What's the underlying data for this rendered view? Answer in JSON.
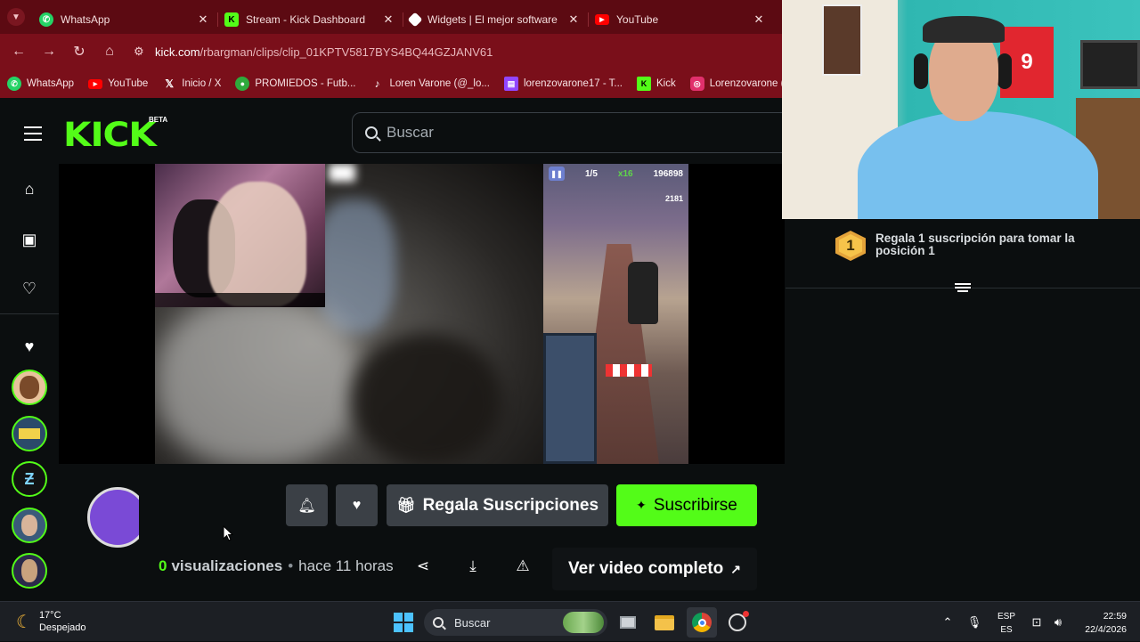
{
  "browser": {
    "tabs": [
      {
        "title": "WhatsApp",
        "icon": "whatsapp-icon",
        "color": "#25d366"
      },
      {
        "title": "Stream - Kick Dashboard",
        "icon": "kick-icon",
        "color": "#53fc18"
      },
      {
        "title": "Widgets | El mejor software",
        "icon": "widget-icon",
        "color": "#ffffff"
      },
      {
        "title": "YouTube",
        "icon": "youtube-icon",
        "color": "#ff0000"
      }
    ],
    "close_glyph": "✕",
    "url_host": "kick.com",
    "url_path": "/rbargman/clips/clip_01KPTV5817BYS4BQ44GZJANV61",
    "bookmarks": [
      {
        "label": "WhatsApp",
        "icon": "whatsapp-icon",
        "color": "#25d366"
      },
      {
        "label": "YouTube",
        "icon": "youtube-icon",
        "color": "#ff0000"
      },
      {
        "label": "Inicio / X",
        "icon": "x-icon",
        "color": "#000000"
      },
      {
        "label": "PROMIEDOS - Futb...",
        "icon": "promiedos-icon",
        "color": "#2eaa3c"
      },
      {
        "label": "Loren Varone (@_lo...",
        "icon": "tiktok-icon",
        "color": "#000000"
      },
      {
        "label": "lorenzovarone17 - T...",
        "icon": "twitch-icon",
        "color": "#9146ff"
      },
      {
        "label": "Kick",
        "icon": "kick-icon",
        "color": "#53fc18"
      },
      {
        "label": "Lorenzovarone (Inst...",
        "icon": "instagram-icon",
        "color": "#e1306c"
      }
    ]
  },
  "kick": {
    "logo": "KICK",
    "beta": "BETA",
    "search_placeholder": "Buscar",
    "game_hud": {
      "page": "1/5",
      "mult": "x16",
      "score": "196898",
      "coins": "2181"
    },
    "actions": {
      "gift_label": "Regala Suscripciones",
      "subscribe_label": "Suscribirse",
      "views_count": "0",
      "views_label": "visualizaciones",
      "separator": "•",
      "time_ago": "hace 11 horas",
      "full_video_label": "Ver video completo"
    },
    "colors": {
      "accent": "#53fc18",
      "background": "#0b0e0f",
      "button": "#3b4046"
    }
  },
  "chat": {
    "rank_number": "1",
    "rank_text": "Regala 1 suscripción para tomar la posición 1"
  },
  "webcam": {
    "shirt_number": "9"
  },
  "taskbar": {
    "temperature": "17°C",
    "weather": "Despejado",
    "search_placeholder": "Buscar",
    "lang_top": "ESP",
    "lang_bottom": "ES",
    "time": "22:59",
    "date": "22/4/2026"
  }
}
